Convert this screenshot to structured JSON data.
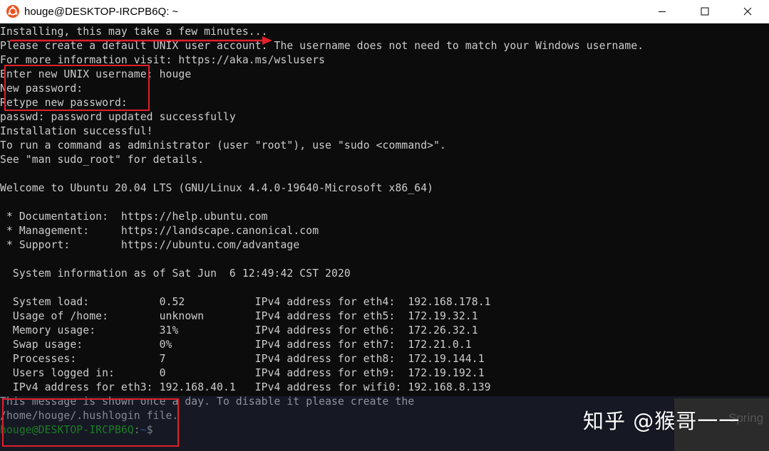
{
  "window": {
    "title": "houge@DESKTOP-IRCPB6Q: ~",
    "app_icon": "ubuntu-icon",
    "controls": [
      "minimize-icon",
      "maximize-icon",
      "close-icon"
    ]
  },
  "terminal": {
    "lines": [
      "Installing, this may take a few minutes...",
      "Please create a default UNIX user account. The username does not need to match your Windows username.",
      "For more information visit: https://aka.ms/wslusers",
      "Enter new UNIX username: houge",
      "New password:",
      "Retype new password:",
      "passwd: password updated successfully",
      "Installation successful!",
      "To run a command as administrator (user \"root\"), use \"sudo <command>\".",
      "See \"man sudo_root\" for details.",
      "",
      "Welcome to Ubuntu 20.04 LTS (GNU/Linux 4.4.0-19640-Microsoft x86_64)",
      "",
      " * Documentation:  https://help.ubuntu.com",
      " * Management:     https://landscape.canonical.com",
      " * Support:        https://ubuntu.com/advantage",
      "",
      "  System information as of Sat Jun  6 12:49:42 CST 2020",
      "",
      "  System load:           0.52           IPv4 address for eth4:  192.168.178.1",
      "  Usage of /home:        unknown        IPv4 address for eth5:  172.19.32.1",
      "  Memory usage:          31%            IPv4 address for eth6:  172.26.32.1",
      "  Swap usage:            0%             IPv4 address for eth7:  172.21.0.1",
      "  Processes:             7              IPv4 address for eth8:  172.19.144.1",
      "  Users logged in:       0              IPv4 address for eth9:  172.19.192.1",
      "  IPv4 address for eth3: 192.168.40.1   IPv4 address for wifi0: 192.168.8.139",
      "This message is shown once a day. To disable it please create the",
      "/home/houge/.hushlogin file."
    ],
    "prompt": {
      "user_host": "houge@DESKTOP-IRCPB6Q",
      "separator": ":",
      "path": "~",
      "sign": "$"
    },
    "colors": {
      "background": "#0c0c0c",
      "text": "#cccccc",
      "prompt_user": "#16c60c",
      "prompt_path": "#3b78ff",
      "annotation": "#e0202a"
    }
  },
  "overlay": {
    "watermark": "知乎 @猴哥一一",
    "side_text": "Spring"
  }
}
